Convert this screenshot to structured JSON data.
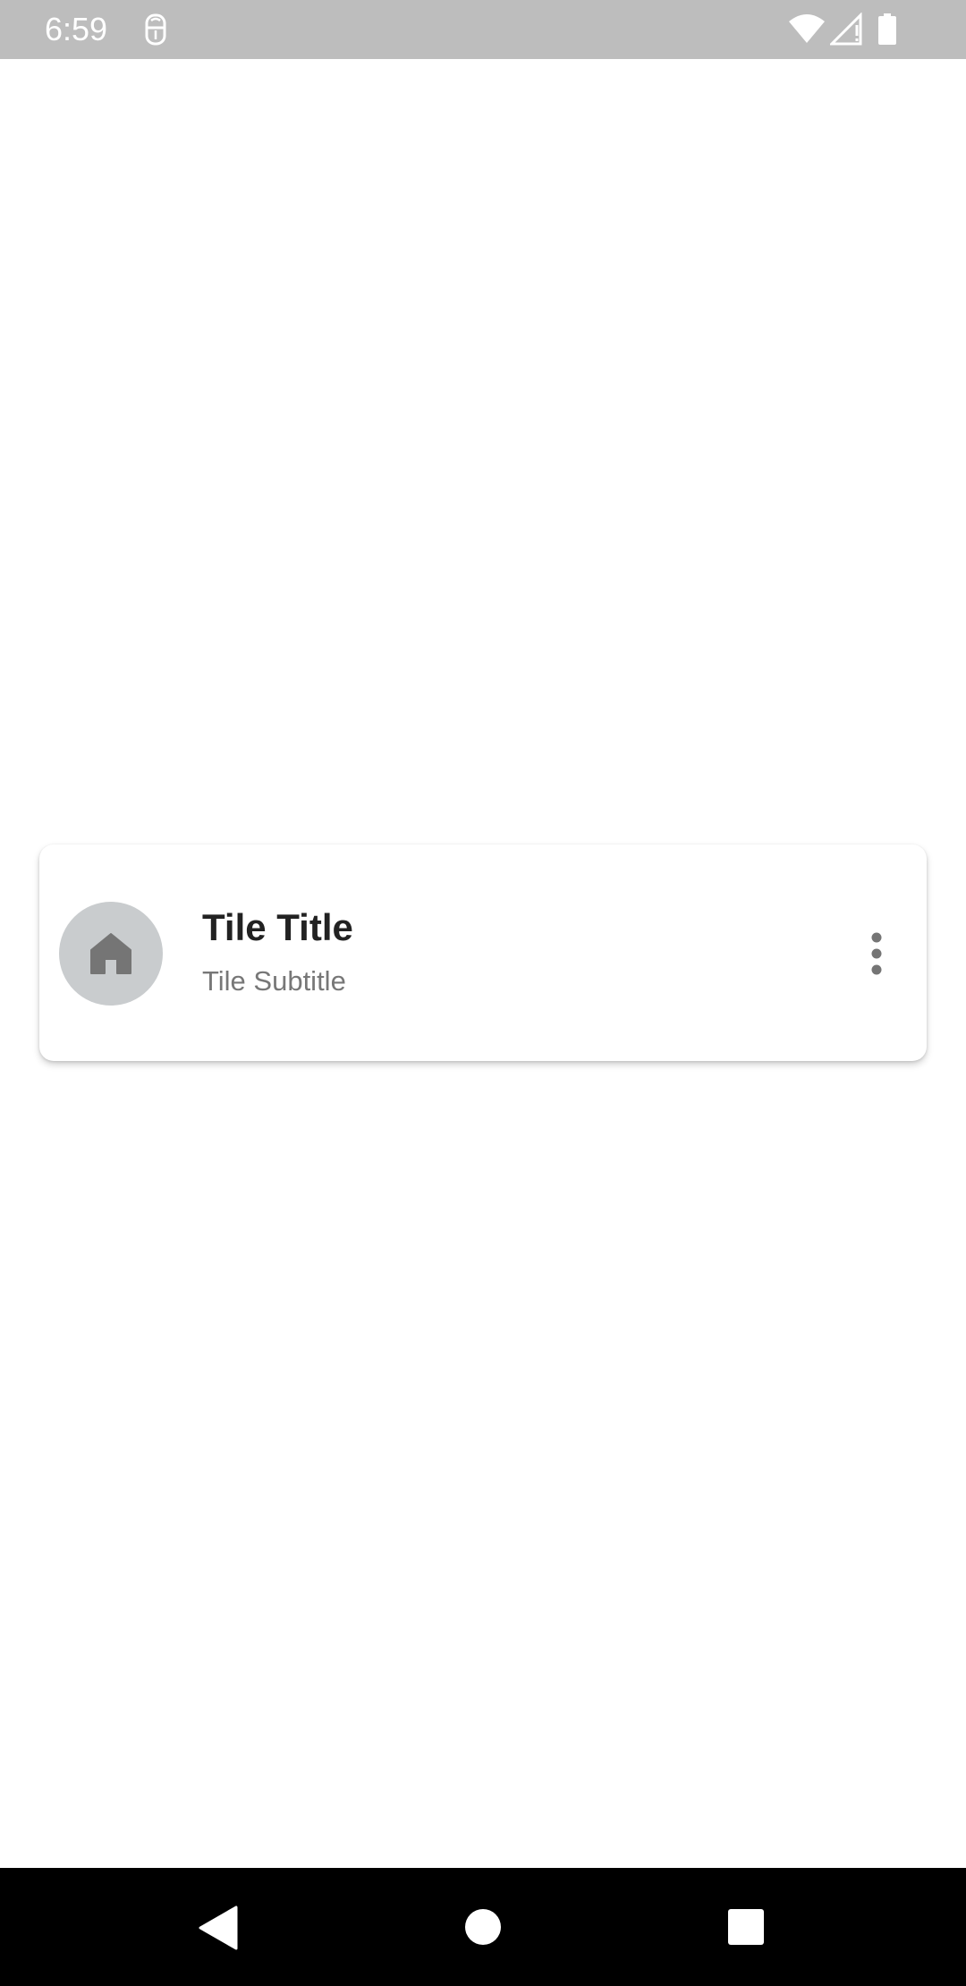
{
  "status_bar": {
    "time": "6:59",
    "icons": [
      "notification-app-icon",
      "wifi-icon",
      "cellular-signal-icon",
      "battery-icon"
    ]
  },
  "tile": {
    "leading_icon": "home-icon",
    "title": "Tile Title",
    "subtitle": "Tile Subtitle",
    "trailing_icon": "more-vert-icon"
  },
  "nav_bar": {
    "buttons": [
      "back-icon",
      "home-icon",
      "recents-icon"
    ]
  },
  "colors": {
    "status_bar_bg": "#bdbdbd",
    "avatar_bg": "#c9ccce",
    "icon_gray": "#757575",
    "title_text": "#222222",
    "subtitle_text": "#777777",
    "nav_bar_bg": "#000000"
  }
}
